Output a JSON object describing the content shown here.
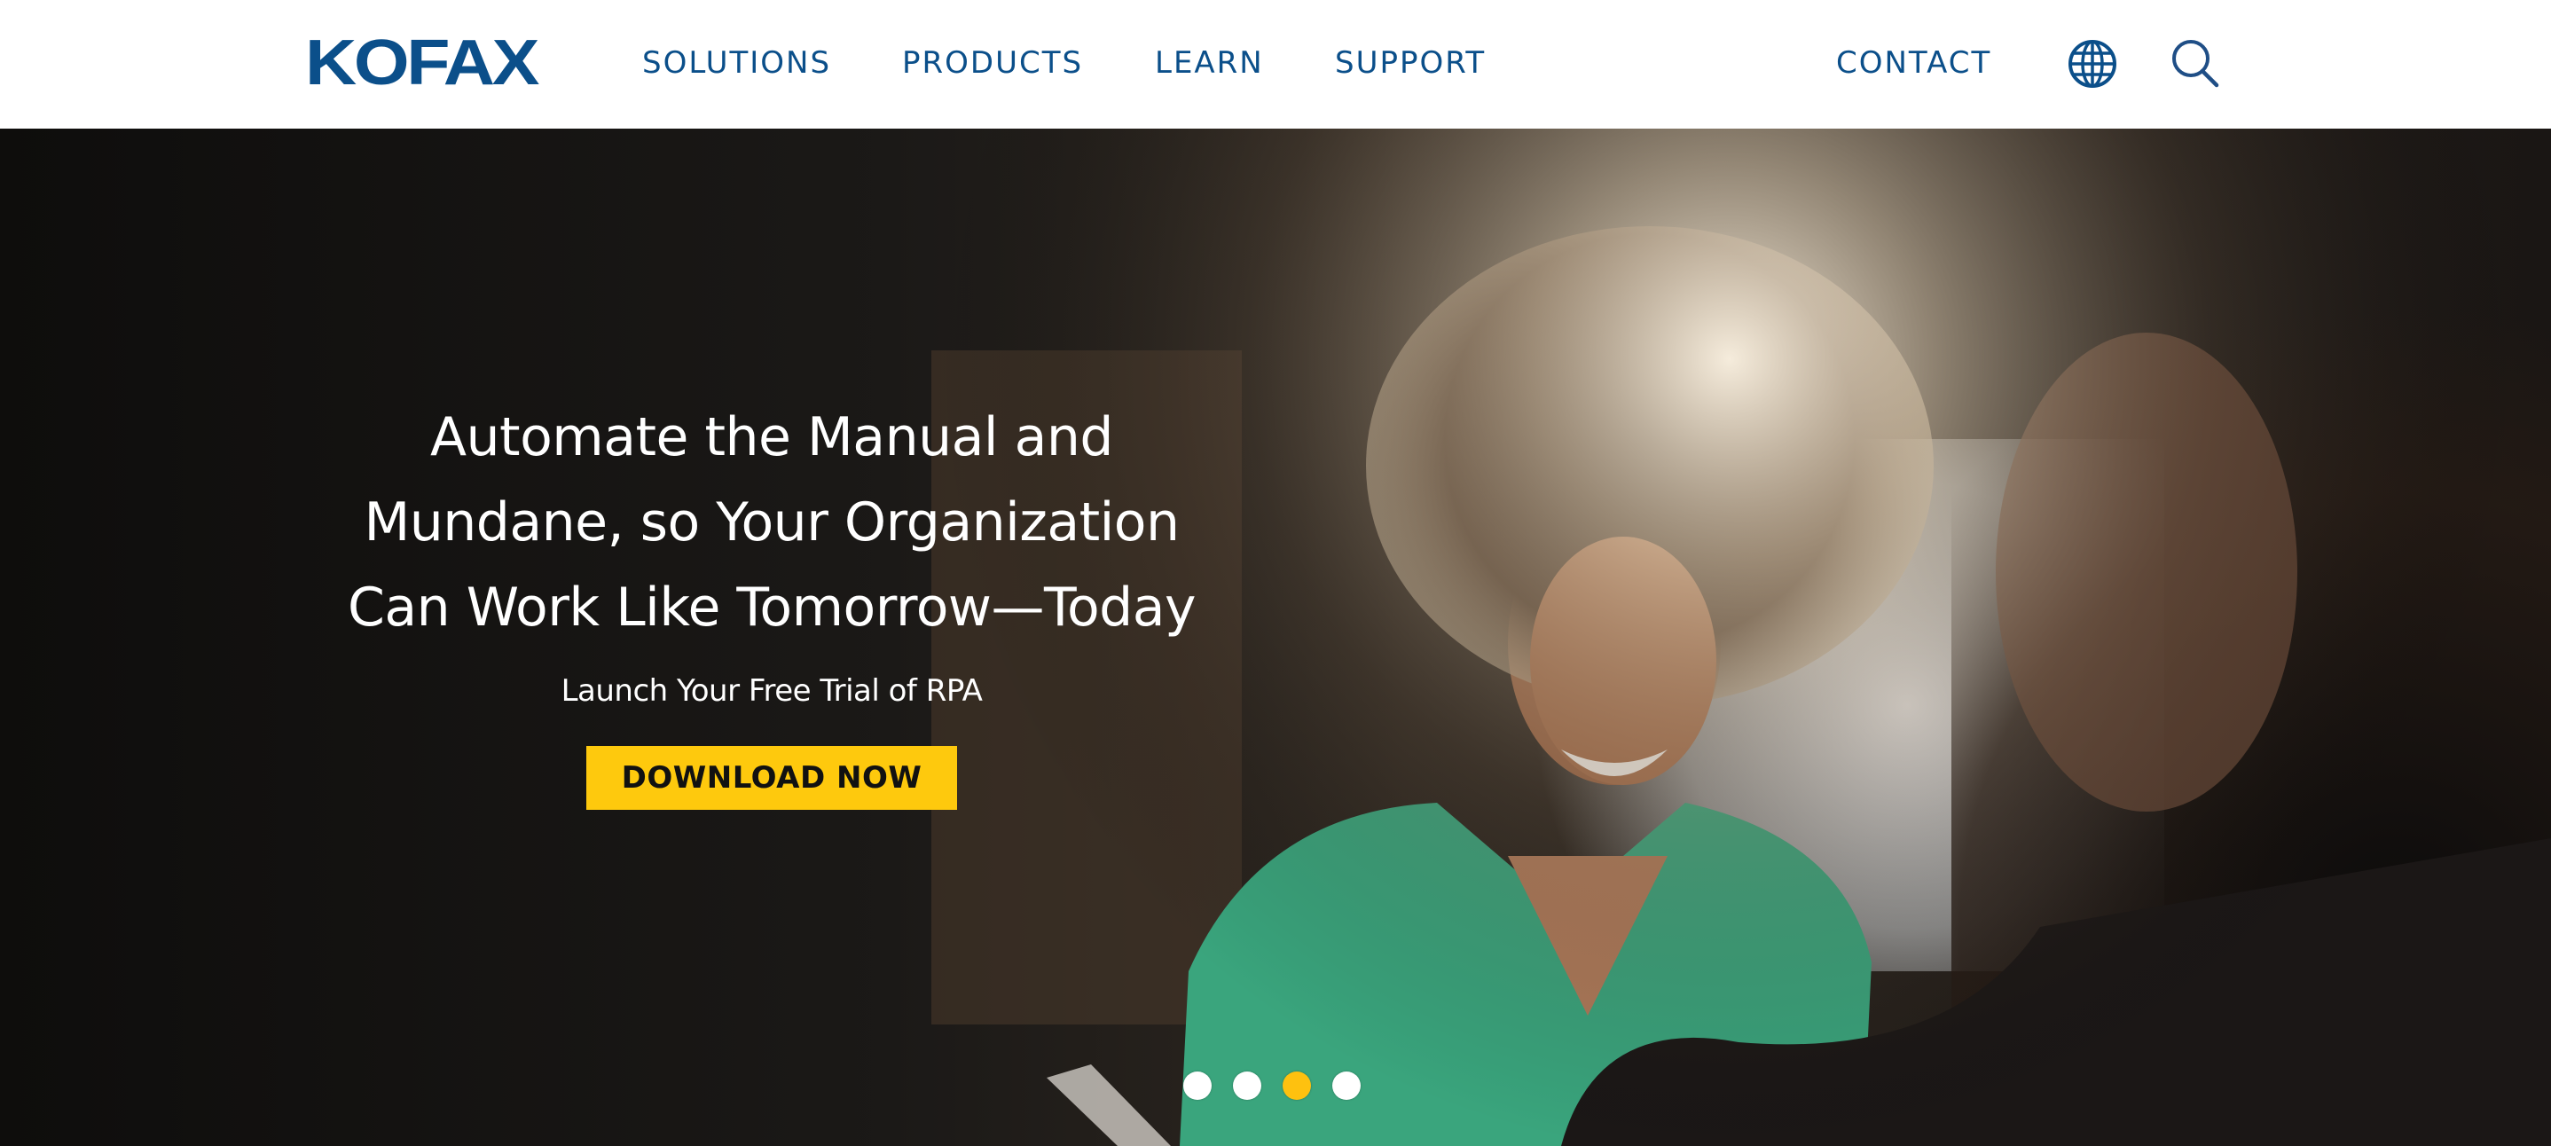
{
  "header": {
    "logo_text": "KOFAX",
    "nav": [
      {
        "label": "SOLUTIONS"
      },
      {
        "label": "PRODUCTS"
      },
      {
        "label": "LEARN"
      },
      {
        "label": "SUPPORT"
      }
    ],
    "contact_label": "CONTACT",
    "icons": {
      "language": "globe-icon",
      "search": "search-icon"
    }
  },
  "hero": {
    "title_lines": [
      "Automate the Manual and",
      "Mundane, so Your Organization",
      "Can Work Like Tomorrow—Today"
    ],
    "subtitle": "Launch Your Free Trial of RPA",
    "cta_label": "DOWNLOAD NOW",
    "carousel": {
      "slide_count": 4,
      "active_index": 2
    }
  },
  "colors": {
    "brand_blue": "#0b4f8a",
    "cta_yellow": "#fec90d",
    "active_dot": "#fec10f"
  }
}
